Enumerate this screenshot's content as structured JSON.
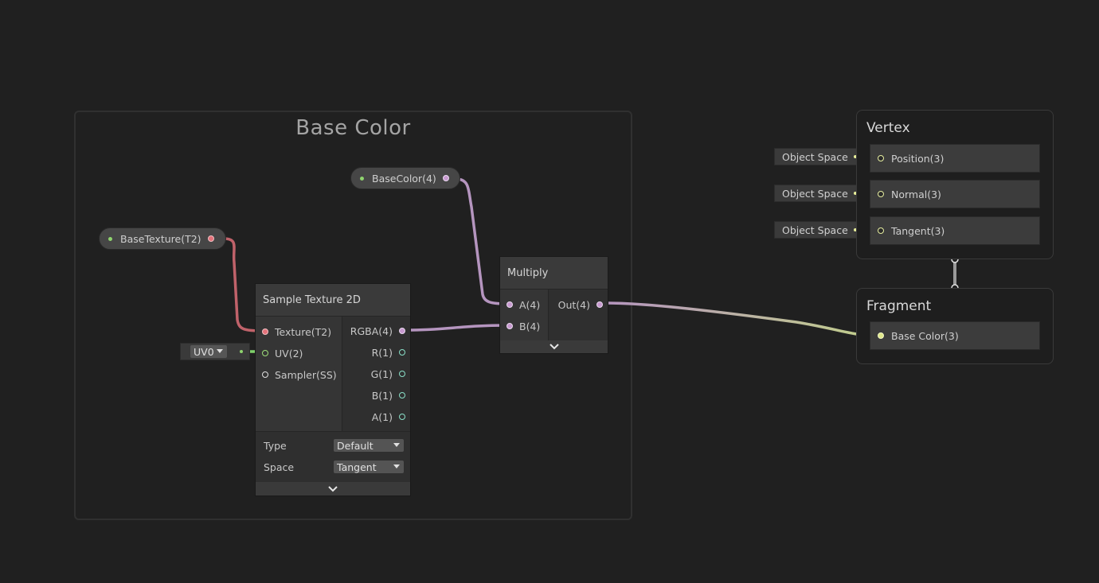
{
  "group": {
    "title": "Base Color"
  },
  "properties": {
    "base_color": "BaseColor(4)",
    "base_texture": "BaseTexture(T2)"
  },
  "sample_texture": {
    "title": "Sample Texture 2D",
    "inputs": [
      "Texture(T2)",
      "UV(2)",
      "Sampler(SS)"
    ],
    "outputs": [
      "RGBA(4)",
      "R(1)",
      "G(1)",
      "B(1)",
      "A(1)"
    ],
    "type_label": "Type",
    "type_value": "Default",
    "space_label": "Space",
    "space_value": "Tangent",
    "uv_value": "UV0"
  },
  "multiply": {
    "title": "Multiply",
    "inputs": [
      "A(4)",
      "B(4)"
    ],
    "output": "Out(4)"
  },
  "vertex": {
    "title": "Vertex",
    "blocks": [
      "Position(3)",
      "Normal(3)",
      "Tangent(3)"
    ],
    "inline": [
      "Object Space",
      "Object Space",
      "Object Space"
    ]
  },
  "fragment": {
    "title": "Fragment",
    "blocks": [
      "Base Color(3)"
    ]
  },
  "colors": {
    "background": "#202020",
    "texture_wire": "#c0626a",
    "vector4_wire": "#b595bf",
    "vector3_wire": "#c2d08a",
    "vector2_wire": "#7fd16a"
  }
}
